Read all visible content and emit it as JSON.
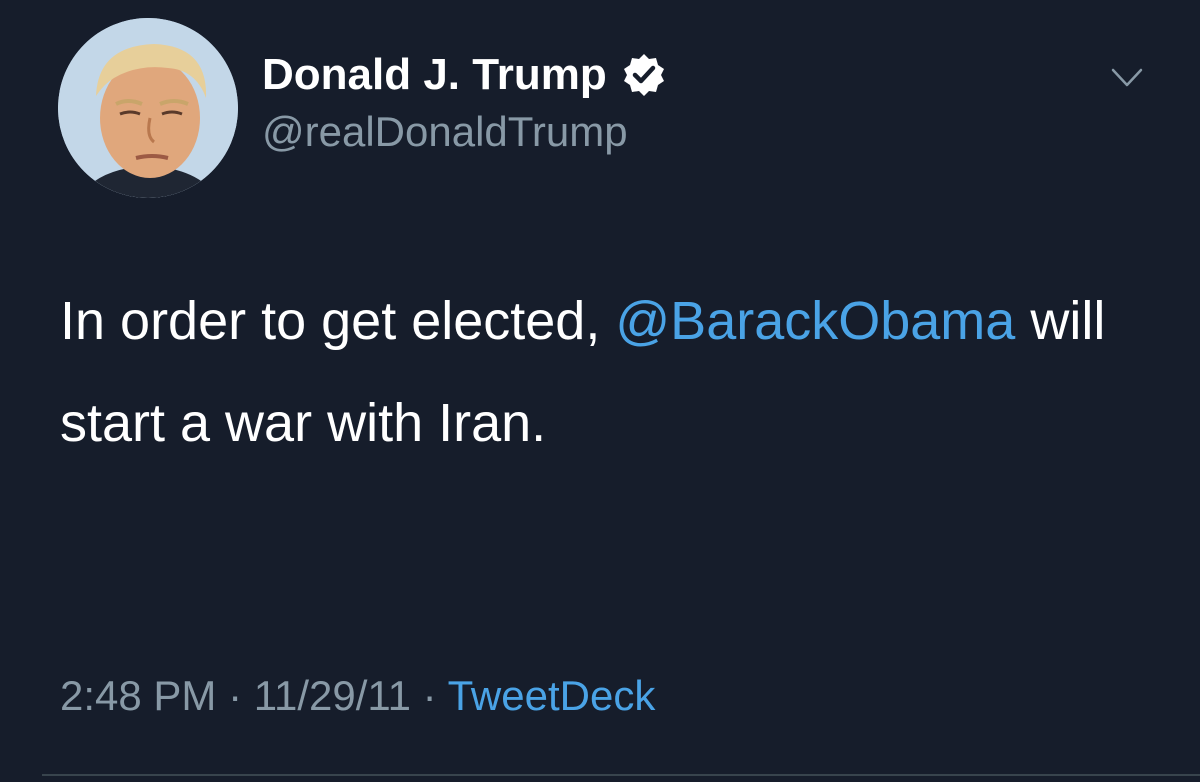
{
  "author": {
    "display_name": "Donald J. Trump",
    "handle": "@realDonaldTrump",
    "verified": true
  },
  "tweet": {
    "text_part1": "In order to get elected, ",
    "mention": "@BarackObama",
    "text_part2": " will start a war with Iran."
  },
  "meta": {
    "time": "2:48 PM",
    "separator": " · ",
    "date": "11/29/11",
    "source": "TweetDeck"
  },
  "colors": {
    "background": "#161d2b",
    "accent": "#4aa3e6",
    "secondary_text": "#8899a6"
  },
  "icons": {
    "verified": "verified-badge-icon",
    "menu": "chevron-down-icon"
  }
}
